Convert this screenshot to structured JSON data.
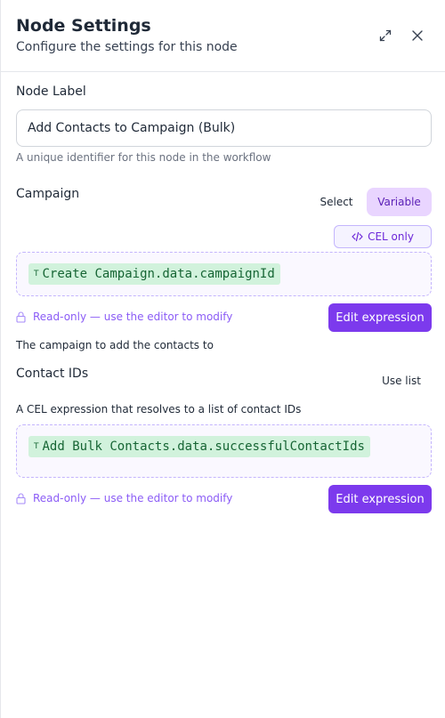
{
  "header": {
    "title": "Node Settings",
    "subtitle": "Configure the settings for this node",
    "expand_icon": "expand-icon",
    "close_icon": "close-icon"
  },
  "node_label": {
    "label": "Node Label",
    "value": "Add Contacts to Campaign (Bulk)",
    "hint": "A unique identifier for this node in the workflow"
  },
  "campaign": {
    "label": "Campaign",
    "toggle_select": "Select",
    "toggle_variable": "Variable",
    "cel_badge": "CEL only",
    "chip_type": "T",
    "expression": "Create Campaign.data.campaignId",
    "readonly_text": "Read-only — use the editor to modify",
    "edit_button": "Edit expression",
    "description": "The campaign to add the contacts to"
  },
  "contact_ids": {
    "label": "Contact IDs",
    "use_list": "Use list",
    "description": "A CEL expression that resolves to a list of contact IDs",
    "chip_type": "T",
    "expression": "Add Bulk Contacts.data.successfulContactIds",
    "readonly_text": "Read-only — use the editor to modify",
    "edit_button": "Edit expression"
  },
  "colors": {
    "accent": "#7c3aed",
    "accent_light": "#e9d5ff",
    "chip_bg": "#d1f2dc",
    "chip_text": "#166534",
    "readonly_text": "#8b5cf6"
  }
}
